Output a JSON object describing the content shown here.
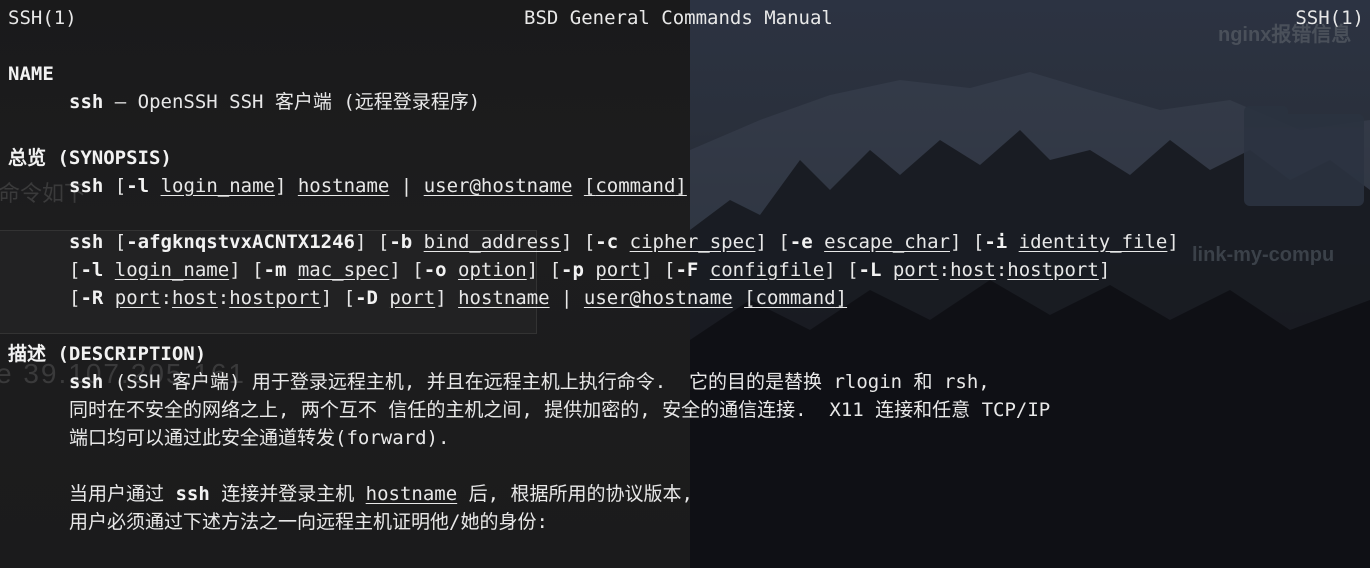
{
  "header": {
    "left": "SSH(1)",
    "center": "BSD General Commands Manual",
    "right": "SSH(1)"
  },
  "background": {
    "behind_text_1": "命令如下",
    "behind_text_2": "e 39.107.205.161",
    "desktop_label_1": "nginx报错信息",
    "desktop_label_2": "link-my-compu"
  },
  "name_section": {
    "heading": "NAME",
    "cmd": "ssh",
    "desc": " — OpenSSH SSH 客户端 (远程登录程序)"
  },
  "synopsis": {
    "heading": "总览 (SYNOPSIS)",
    "line1": {
      "cmd": "ssh",
      "opt": "-l",
      "arg1": "login_name",
      "arg2": "hostname",
      "arg3": "user@hostname",
      "arg4": "command"
    },
    "line2": {
      "cmd": "ssh",
      "opts": "-afgknqstvxACNTX1246",
      "b": "-b",
      "bind_address": "bind_address",
      "c": "-c",
      "cipher_spec": "cipher_spec",
      "e": "-e",
      "escape_char": "escape_char",
      "i": "-i",
      "identity_file": "identity_file"
    },
    "line3": {
      "l": "-l",
      "login_name": "login_name",
      "m": "-m",
      "mac_spec": "mac_spec",
      "o": "-o",
      "option": "option",
      "p": "-p",
      "port": "port",
      "F": "-F",
      "configfile": "configfile",
      "L": "-L",
      "host": "host",
      "hostport": "hostport"
    },
    "line4": {
      "R": "-R",
      "port": "port",
      "host": "host",
      "hostport": "hostport",
      "D": "-D",
      "dport": "port",
      "hostname": "hostname",
      "user_at_host": "user@hostname",
      "command": "command"
    }
  },
  "description": {
    "heading": "描述 (DESCRIPTION)",
    "p1_cmd": "ssh",
    "p1_line1": " (SSH 客户端) 用于登录远程主机, 并且在远程主机上执行命令.  它的目的是替换 rlogin 和 rsh,",
    "p1_line2": "同时在不安全的网络之上, 两个互不 信任的主机之间, 提供加密的, 安全的通信连接.  X11 连接和任意 TCP/IP",
    "p1_line3": "端口均可以通过此安全通道转发(forward).",
    "p2_pre": "当用户通过 ",
    "p2_cmd": "ssh",
    "p2_mid": " 连接并登录主机 ",
    "p2_host": "hostname",
    "p2_post": " 后, 根据所用的协议版本,",
    "p2_line2": "用户必须通过下述方法之一向远程主机证明他/她的身份:"
  }
}
